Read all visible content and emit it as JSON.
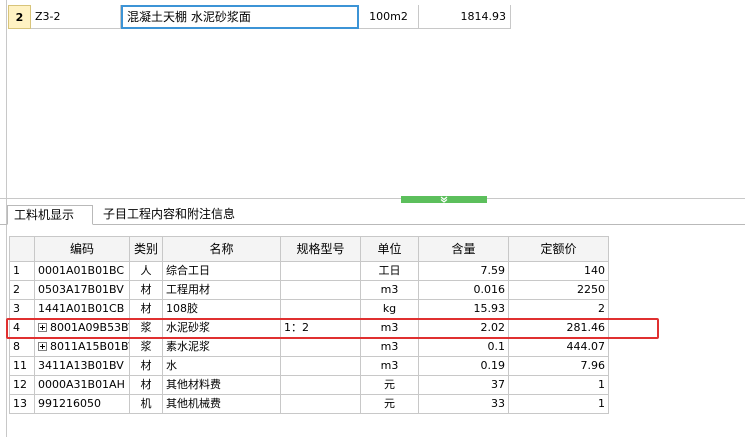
{
  "quota_row": {
    "index": "2",
    "code": "Z3-2",
    "name": "混凝土天棚 水泥砂浆面",
    "unit": "100m2",
    "value": "1814.93"
  },
  "tabs": [
    {
      "label": "工料机显示",
      "active": true
    },
    {
      "label": "子目工程内容和附注信息",
      "active": false
    }
  ],
  "grid": {
    "headers": [
      "",
      "编码",
      "类别",
      "名称",
      "规格型号",
      "单位",
      "含量",
      "定额价"
    ],
    "rows": [
      {
        "idx": "1",
        "code": "0001A01B01BC",
        "expandable": false,
        "type": "人",
        "name": "综合工日",
        "spec": "",
        "unit": "工日",
        "qty": "7.59",
        "price": "140"
      },
      {
        "idx": "2",
        "code": "0503A17B01BV",
        "expandable": false,
        "type": "材",
        "name": "工程用材",
        "spec": "",
        "unit": "m3",
        "qty": "0.016",
        "price": "2250"
      },
      {
        "idx": "3",
        "code": "1441A01B01CB",
        "expandable": false,
        "type": "材",
        "name": "108胶",
        "spec": "",
        "unit": "kg",
        "qty": "15.93",
        "price": "2"
      },
      {
        "idx": "4",
        "code": "8001A09B53BV",
        "expandable": true,
        "type": "浆",
        "name": "水泥砂浆",
        "spec": "1：2",
        "unit": "m3",
        "qty": "2.02",
        "price": "281.46"
      },
      {
        "idx": "8",
        "code": "8011A15B01BV",
        "expandable": true,
        "type": "浆",
        "name": "素水泥浆",
        "spec": "",
        "unit": "m3",
        "qty": "0.1",
        "price": "444.07"
      },
      {
        "idx": "11",
        "code": "3411A13B01BV",
        "expandable": false,
        "type": "材",
        "name": "水",
        "spec": "",
        "unit": "m3",
        "qty": "0.19",
        "price": "7.96"
      },
      {
        "idx": "12",
        "code": "0000A31B01AH",
        "expandable": false,
        "type": "材",
        "name": "其他材料费",
        "spec": "",
        "unit": "元",
        "qty": "37",
        "price": "1"
      },
      {
        "idx": "13",
        "code": "991216050",
        "expandable": false,
        "type": "机",
        "name": "其他机械费",
        "spec": "",
        "unit": "元",
        "qty": "33",
        "price": "1"
      }
    ]
  },
  "colors": {
    "highlight": "#e03030",
    "splitter": "#5cbf5c",
    "selected_border": "#3c94d6",
    "row_index_bg": "#fff2c3"
  },
  "icons": {
    "splitter": "chevron-down-double-icon",
    "expander": "plus-box-icon"
  }
}
